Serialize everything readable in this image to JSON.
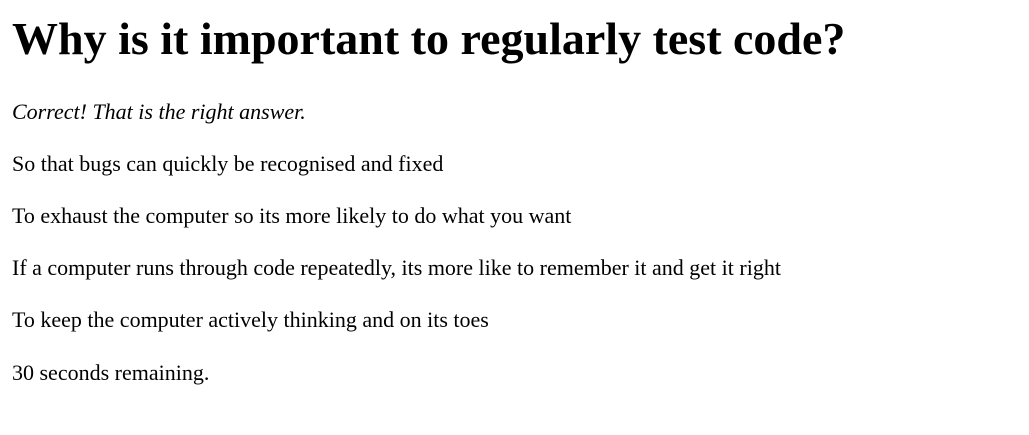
{
  "quiz": {
    "question": "Why is it important to regularly test code?",
    "feedback": "Correct! That is the right answer.",
    "answers": [
      "So that bugs can quickly be recognised and fixed",
      "To exhaust the computer so its more likely to do what you want",
      "If a computer runs through code repeatedly, its more like to remember it and get it right",
      "To keep the computer actively thinking and on its toes"
    ],
    "timer": "30 seconds remaining."
  }
}
